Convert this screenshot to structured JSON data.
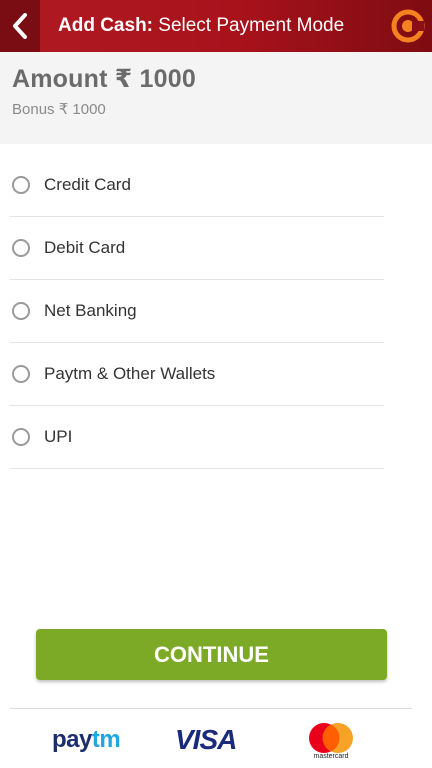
{
  "header": {
    "title_bold": "Add Cash:",
    "title_rest": "Select Payment Mode",
    "back_icon": "chevron-left-icon",
    "logo_icon": "brand-logo-icon"
  },
  "amount": {
    "amount_text": "Amount ₹ 1000",
    "bonus_text": "Bonus ₹ 1000"
  },
  "payment_options": [
    {
      "label": "Credit Card"
    },
    {
      "label": "Debit Card"
    },
    {
      "label": "Net Banking"
    },
    {
      "label": "Paytm & Other Wallets"
    },
    {
      "label": "UPI"
    }
  ],
  "continue_label": "CONTINUE",
  "logos": {
    "paytm_pay": "pay",
    "paytm_tm": "tm",
    "visa": "VISA",
    "mastercard": "mastercard"
  },
  "colors": {
    "header": "#a8121b",
    "continue": "#7daa26"
  }
}
